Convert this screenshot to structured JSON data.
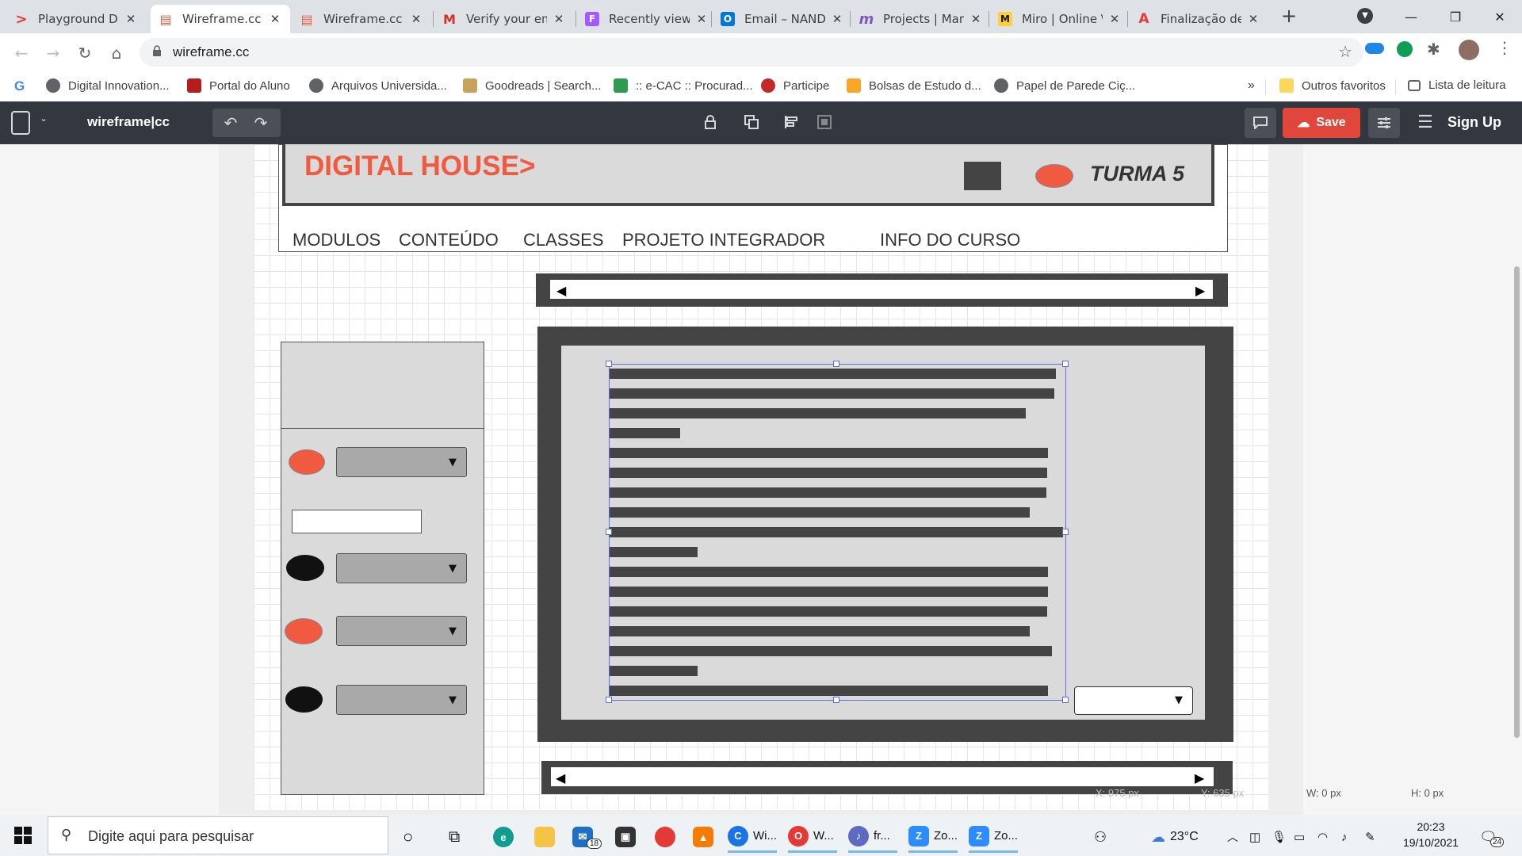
{
  "browser": {
    "tabs": [
      {
        "label": "Playground Di",
        "color": "#e53935",
        "glyph": ">"
      },
      {
        "label": "Wireframe.cc |",
        "color": "#f05a41",
        "glyph": "▤"
      },
      {
        "label": "Wireframe.cc |",
        "color": "#f05a41",
        "glyph": "▤"
      },
      {
        "label": "Verify your em",
        "color": "#d93025",
        "glyph": "M"
      },
      {
        "label": "Recently viewe",
        "color": "#a259ff",
        "glyph": "F"
      },
      {
        "label": "Email – NAND",
        "color": "#0078d4",
        "glyph": "O"
      },
      {
        "label": "Projects | Mar",
        "color": "#7e57c2",
        "glyph": "m"
      },
      {
        "label": "Miro | Online \\",
        "color": "#ffd02f",
        "glyph": "M"
      },
      {
        "label": "Finalização de",
        "color": "#e53935",
        "glyph": "A"
      }
    ],
    "new_tab": "+",
    "url": "wireframe.cc",
    "bookmarks": [
      {
        "label": "Digital Innovation...",
        "color": "#5f6368"
      },
      {
        "label": "Portal do Aluno",
        "color": "#b71c1c"
      },
      {
        "label": "Arquivos Universida...",
        "color": "#5f6368"
      },
      {
        "label": "Goodreads | Search...",
        "color": "#c8a15a"
      },
      {
        "label": ":: e-CAC :: Procurad...",
        "color": "#2e9c4f"
      },
      {
        "label": "Participe",
        "color": "#c62828"
      },
      {
        "label": "Bolsas de Estudo d...",
        "color": "#f9a825"
      },
      {
        "label": "Papel de Parede Ciç...",
        "color": "#5f6368"
      }
    ],
    "bookmarks_more": "»",
    "other_favorites": "Outros favoritos",
    "reading_list": "Lista de leitura"
  },
  "app": {
    "logo": "wireframe|cc",
    "save_label": "Save",
    "signup_label": "Sign Up"
  },
  "wireframe": {
    "brand": "DIGITAL HOUSE>",
    "turma": "TURMA 5",
    "nav": [
      "MODULOS",
      "CONTEÚDO",
      "CLASSES",
      "PROJETO INTEGRADOR",
      "INFO DO CURSO"
    ]
  },
  "status": {
    "x": "X: 975 px",
    "y": "Y: 635 px",
    "w": "W: 0 px",
    "h": "H: 0 px"
  },
  "taskbar": {
    "search_placeholder": "Digite aqui para pesquisar",
    "apps": [
      {
        "label": "Wi...",
        "color": "#1a73e8",
        "glyph": "C"
      },
      {
        "label": "W...",
        "color": "#e53935",
        "glyph": "O"
      },
      {
        "label": "fr...",
        "color": "#5c6bc0",
        "glyph": "♪"
      },
      {
        "label": "Zo...",
        "color": "#2d8cff",
        "glyph": "Z"
      },
      {
        "label": "Zo...",
        "color": "#2d8cff",
        "glyph": "Z"
      }
    ],
    "mail_badge": "18",
    "temperature": "23°C",
    "time": "20:23",
    "date": "19/10/2021",
    "notifications": "24"
  },
  "colors": {
    "accent_red": "#f05a41",
    "toolbar_bg": "#333840",
    "save_bg": "#e0473a"
  }
}
